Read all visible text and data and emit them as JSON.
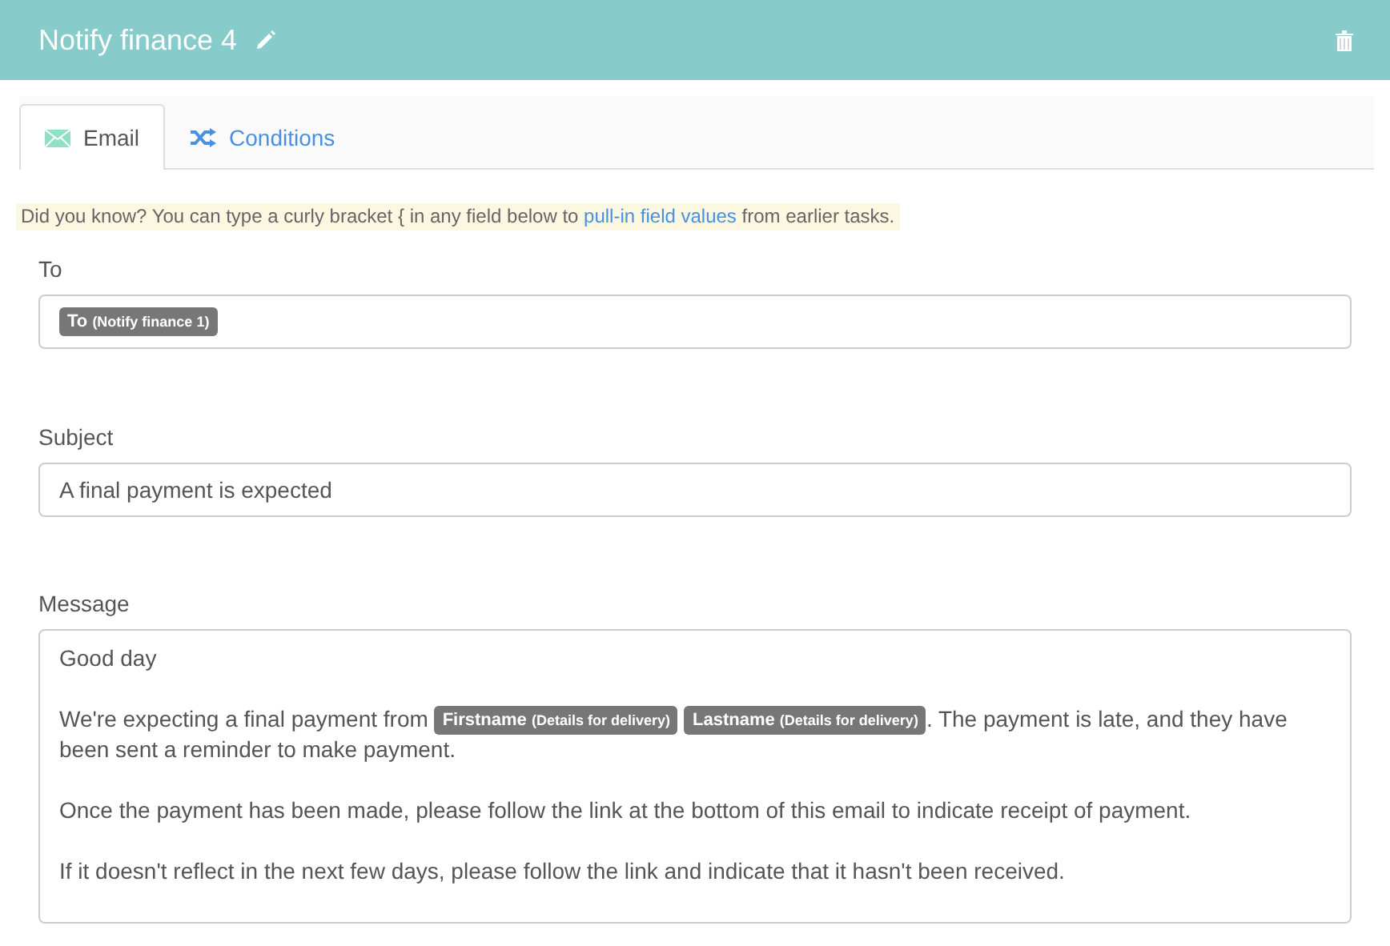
{
  "header": {
    "title": "Notify finance 4"
  },
  "tabs": [
    {
      "label": "Email",
      "kind": "email",
      "selected": true
    },
    {
      "label": "Conditions",
      "kind": "conditions",
      "selected": false
    }
  ],
  "tip": {
    "before": "Did you know? You can type a curly bracket { in any field below to ",
    "link": "pull-in field values",
    "after": " from earlier tasks."
  },
  "fields": [
    {
      "label": "To",
      "kind": "tokens",
      "tokens": [
        {
          "name": "To",
          "source": "(Notify finance 1)"
        }
      ]
    },
    {
      "label": "Subject",
      "kind": "text",
      "value": "A final payment is expected"
    },
    {
      "label": "Message",
      "kind": "message",
      "paragraphs": [
        [
          {
            "kind": "text",
            "text": "Good day"
          }
        ],
        [
          {
            "kind": "text",
            "text": "We're expecting a final payment from "
          },
          {
            "kind": "token",
            "name": "Firstname",
            "source": "(Details for delivery)"
          },
          {
            "kind": "token",
            "name": "Lastname",
            "source": "(Details for delivery)"
          },
          {
            "kind": "text",
            "text": ". The payment is late, and they have been sent a reminder to make payment."
          }
        ],
        [
          {
            "kind": "text",
            "text": "Once the payment has been made, please follow the link at the bottom of this email to indicate receipt of payment."
          }
        ],
        [
          {
            "kind": "text",
            "text": "If it doesn't reflect in the next few days, please follow the link and indicate that it hasn't been received."
          }
        ]
      ]
    }
  ]
}
